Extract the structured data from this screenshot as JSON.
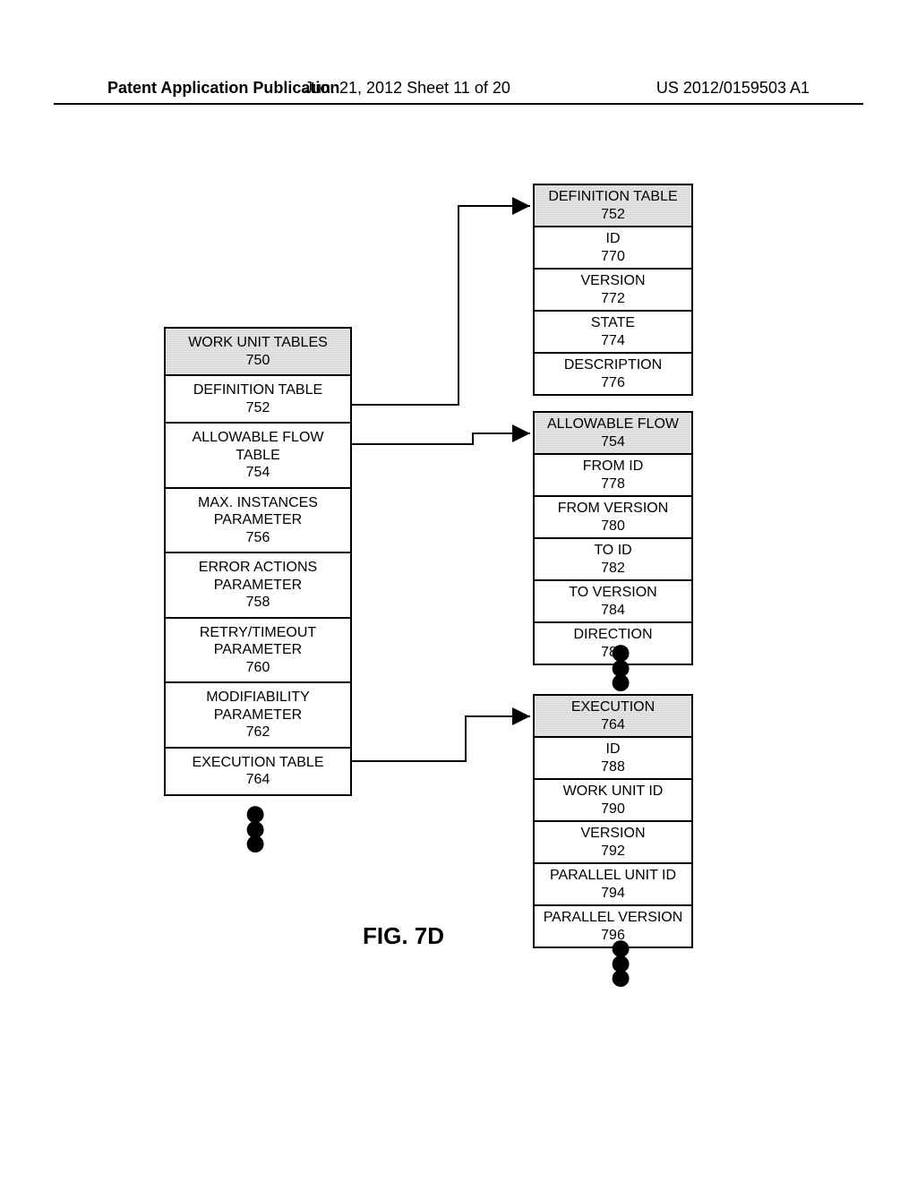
{
  "header": {
    "left": "Patent Application Publication",
    "center": "Jun. 21, 2012  Sheet 11 of 20",
    "right": "US 2012/0159503 A1"
  },
  "figure_label": "FIG. 7D",
  "left_table": {
    "title_line1": "WORK UNIT TABLES",
    "title_line2": "750",
    "rows": [
      {
        "l1": "DEFINITION TABLE",
        "l2": "752"
      },
      {
        "l1": "ALLOWABLE FLOW",
        "l2": "TABLE",
        "l3": "754"
      },
      {
        "l1": "MAX. INSTANCES",
        "l2": "PARAMETER",
        "l3": "756"
      },
      {
        "l1": "ERROR ACTIONS",
        "l2": "PARAMETER",
        "l3": "758"
      },
      {
        "l1": "RETRY/TIMEOUT",
        "l2": "PARAMETER",
        "l3": "760"
      },
      {
        "l1": "MODIFIABILITY",
        "l2": "PARAMETER",
        "l3": "762"
      },
      {
        "l1": "EXECUTION TABLE",
        "l2": "764"
      }
    ]
  },
  "definition_table": {
    "title_line1": "DEFINITION TABLE",
    "title_line2": "752",
    "rows": [
      {
        "l1": "ID",
        "l2": "770"
      },
      {
        "l1": "VERSION",
        "l2": "772"
      },
      {
        "l1": "STATE",
        "l2": "774"
      },
      {
        "l1": "DESCRIPTION",
        "l2": "776"
      }
    ]
  },
  "allowable_flow": {
    "title_line1": "ALLOWABLE FLOW",
    "title_line2": "754",
    "rows": [
      {
        "l1": "FROM ID",
        "l2": "778"
      },
      {
        "l1": "FROM VERSION",
        "l2": "780"
      },
      {
        "l1": "TO ID",
        "l2": "782"
      },
      {
        "l1": "TO VERSION",
        "l2": "784"
      },
      {
        "l1": "DIRECTION",
        "l2": "786"
      }
    ]
  },
  "execution": {
    "title_line1": "EXECUTION",
    "title_line2": "764",
    "rows": [
      {
        "l1": "ID",
        "l2": "788"
      },
      {
        "l1": "WORK UNIT ID",
        "l2": "790"
      },
      {
        "l1": "VERSION",
        "l2": "792"
      },
      {
        "l1": "PARALLEL UNIT ID",
        "l2": "794"
      },
      {
        "l1": "PARALLEL VERSION",
        "l2": "796"
      }
    ]
  }
}
